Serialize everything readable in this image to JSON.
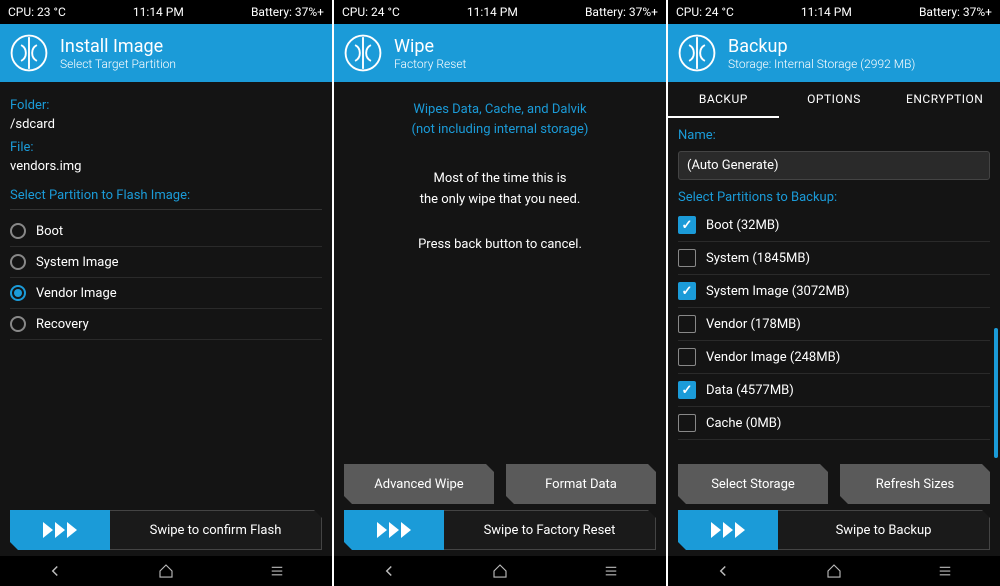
{
  "screen1": {
    "status": {
      "cpu": "CPU: 23 °C",
      "time": "11:14 PM",
      "battery": "Battery: 37%+"
    },
    "header": {
      "title": "Install Image",
      "subtitle": "Select Target Partition"
    },
    "folder_label": "Folder:",
    "folder_value": "/sdcard",
    "file_label": "File:",
    "file_value": "vendors.img",
    "section": "Select Partition to Flash Image:",
    "partitions": [
      {
        "label": "Boot",
        "selected": false
      },
      {
        "label": "System Image",
        "selected": false
      },
      {
        "label": "Vendor Image",
        "selected": true
      },
      {
        "label": "Recovery",
        "selected": false
      }
    ],
    "slider": "Swipe to confirm Flash"
  },
  "screen2": {
    "status": {
      "cpu": "CPU: 24 °C",
      "time": "11:14 PM",
      "battery": "Battery: 37%+"
    },
    "header": {
      "title": "Wipe",
      "subtitle": "Factory Reset"
    },
    "blue_line1": "Wipes Data, Cache, and Dalvik",
    "blue_line2": "(not including internal storage)",
    "white_line1": "Most of the time this is",
    "white_line2": "the only wipe that you need.",
    "white_line3": "Press back button to cancel.",
    "btn1": "Advanced Wipe",
    "btn2": "Format Data",
    "slider": "Swipe to Factory Reset"
  },
  "screen3": {
    "status": {
      "cpu": "CPU: 24 °C",
      "time": "11:14 PM",
      "battery": "Battery: 37%+"
    },
    "header": {
      "title": "Backup",
      "subtitle": "Storage: Internal Storage (2992 MB)"
    },
    "tabs": {
      "t1": "BACKUP",
      "t2": "OPTIONS",
      "t3": "ENCRYPTION"
    },
    "name_label": "Name:",
    "name_value": "(Auto Generate)",
    "section": "Select Partitions to Backup:",
    "partitions": [
      {
        "label": "Boot (32MB)",
        "checked": true
      },
      {
        "label": "System (1845MB)",
        "checked": false
      },
      {
        "label": "System Image (3072MB)",
        "checked": true
      },
      {
        "label": "Vendor (178MB)",
        "checked": false
      },
      {
        "label": "Vendor Image (248MB)",
        "checked": false
      },
      {
        "label": "Data (4577MB)",
        "checked": true
      },
      {
        "label": "Cache (0MB)",
        "checked": false
      }
    ],
    "btn1": "Select Storage",
    "btn2": "Refresh Sizes",
    "slider": "Swipe to Backup"
  }
}
